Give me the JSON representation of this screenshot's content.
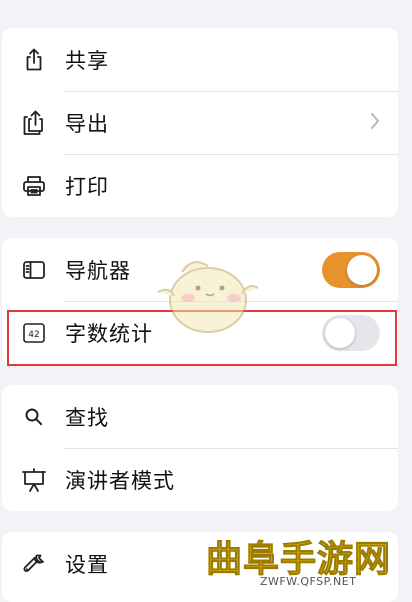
{
  "menu": {
    "group1": [
      {
        "label": "共享",
        "icon": "share-icon"
      },
      {
        "label": "导出",
        "icon": "export-icon"
      },
      {
        "label": "打印",
        "icon": "printer-icon"
      }
    ],
    "group2": [
      {
        "label": "导航器",
        "icon": "sidebar-icon",
        "toggle": true
      },
      {
        "label": "字数统计",
        "icon": "word-count-icon",
        "toggle": false
      }
    ],
    "group3": [
      {
        "label": "查找",
        "icon": "search-icon"
      },
      {
        "label": "演讲者模式",
        "icon": "presenter-icon"
      }
    ],
    "group4": [
      {
        "label": "设置",
        "icon": "wrench-icon"
      }
    ],
    "word_count_badge": "42"
  },
  "colors": {
    "accent": "#e8922e",
    "highlight": "#e53935",
    "background": "#f2f2f7"
  },
  "watermark": {
    "main": "曲阜手游网",
    "sub": "ZWFW.QFSP.NET"
  }
}
